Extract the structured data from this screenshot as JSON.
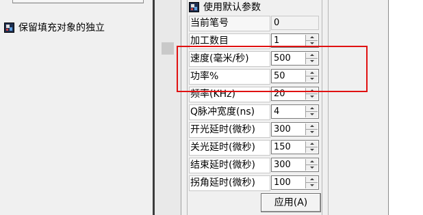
{
  "left_panel": {
    "option_label": "保留填充对象的独立"
  },
  "params_panel": {
    "header": "使用默认参数",
    "rows": [
      {
        "label": "当前笔号",
        "value": "0"
      },
      {
        "label": "加工数目",
        "value": "1"
      },
      {
        "label": "速度(毫米/秒)",
        "value": "500"
      },
      {
        "label": "功率%",
        "value": "50"
      },
      {
        "label": "频率(KHz)",
        "value": "20"
      },
      {
        "label": "Q脉冲宽度(ns)",
        "value": "4"
      },
      {
        "label": "开光延时(微秒)",
        "value": "300"
      },
      {
        "label": "关光延时(微秒)",
        "value": "150"
      },
      {
        "label": "结束延时(微秒)",
        "value": "300"
      },
      {
        "label": "拐角延时(微秒)",
        "value": "100"
      }
    ],
    "apply_button": "应用(A)"
  },
  "colors": {
    "highlight": "#e01010"
  },
  "icons": {
    "option": "palette-icon",
    "header": "palette-icon"
  }
}
